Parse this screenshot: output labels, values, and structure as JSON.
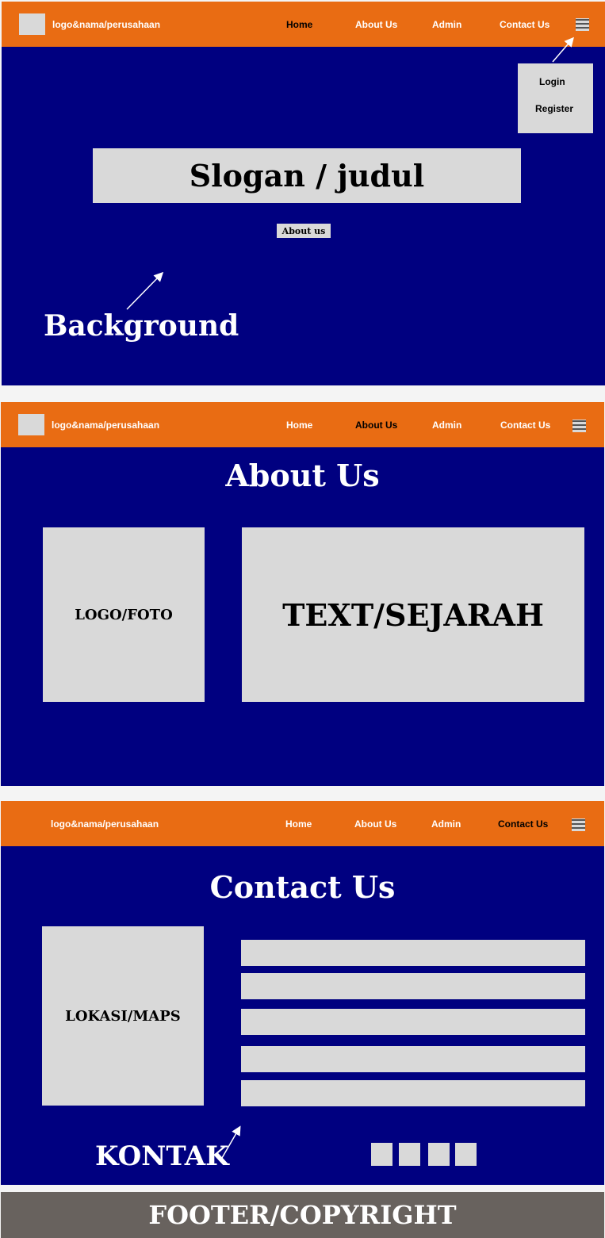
{
  "nav": {
    "brand": "logo&nama/perusahaan",
    "links": [
      "Home",
      "About Us",
      "Admin",
      "Contact Us"
    ]
  },
  "home": {
    "dropdown": [
      "Login",
      "Register"
    ],
    "slogan": "Slogan / judul",
    "about_button": "About us",
    "background_label": "Background"
  },
  "about": {
    "title": "About Us",
    "logo_label": "LOGO/FOTO",
    "text_label": "TEXT/SEJARAH"
  },
  "contact": {
    "title": "Contact Us",
    "map_label": "LOKASI/MAPS",
    "kontak_label": "KONTAK"
  },
  "footer": {
    "label": "FOOTER/COPYRIGHT"
  },
  "colors": {
    "nav": "#e96c13",
    "background": "#000080",
    "placeholder": "#d9d9d9",
    "footer": "#68625e"
  }
}
